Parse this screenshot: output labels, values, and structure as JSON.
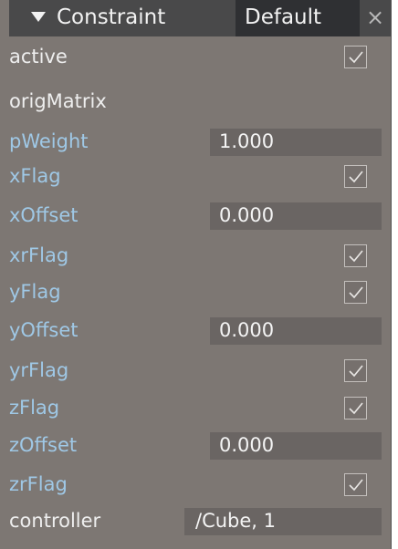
{
  "header": {
    "title": "Constraint",
    "default_label": "Default",
    "close_glyph": "×"
  },
  "rows": {
    "active": {
      "label": "active",
      "checked": true,
      "color": "#eeeeee"
    },
    "origMatrix": {
      "label": "origMatrix",
      "color": "#eeeeee"
    },
    "pWeight": {
      "label": "pWeight",
      "value": "1.000",
      "color": "#9fc8e6"
    },
    "xFlag": {
      "label": "xFlag",
      "checked": true,
      "color": "#9fc8e6"
    },
    "xOffset": {
      "label": "xOffset",
      "value": "0.000",
      "color": "#9fc8e6"
    },
    "xrFlag": {
      "label": "xrFlag",
      "checked": true,
      "color": "#9fc8e6"
    },
    "yFlag": {
      "label": "yFlag",
      "checked": true,
      "color": "#9fc8e6"
    },
    "yOffset": {
      "label": "yOffset",
      "value": "0.000",
      "color": "#9fc8e6"
    },
    "yrFlag": {
      "label": "yrFlag",
      "checked": true,
      "color": "#9fc8e6"
    },
    "zFlag": {
      "label": "zFlag",
      "checked": true,
      "color": "#9fc8e6"
    },
    "zOffset": {
      "label": "zOffset",
      "value": "0.000",
      "color": "#9fc8e6"
    },
    "zrFlag": {
      "label": "zrFlag",
      "checked": true,
      "color": "#9fc8e6"
    },
    "controller": {
      "label": "controller",
      "value": "/Cube, 1",
      "color": "#eeeeee"
    }
  },
  "icons": {
    "collapse": "triangle-down-icon",
    "close": "close-icon",
    "checkbox": "checkmark-icon"
  },
  "colors": {
    "panel_bg": "#7d7773",
    "header_bg": "#49494a",
    "default_bg": "#2f3033",
    "field_bg": "#6a6563",
    "label_plain": "#eeeeee",
    "label_connected": "#9fc8e6"
  }
}
